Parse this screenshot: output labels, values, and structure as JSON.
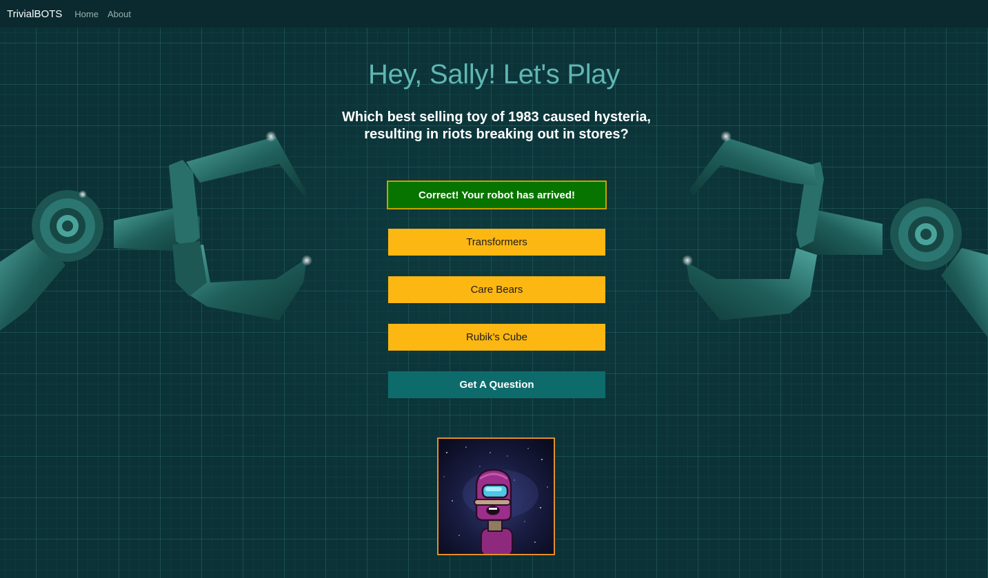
{
  "navbar": {
    "brand": "TrivialBOTS",
    "links": [
      "Home",
      "About"
    ]
  },
  "greeting": "Hey, Sally! Let's Play",
  "question": "Which best selling toy of 1983 caused hysteria, resulting in riots breaking out in stores?",
  "answers": [
    {
      "label": "Correct! Your robot has arrived!",
      "state": "correct"
    },
    {
      "label": "Transformers",
      "state": "default"
    },
    {
      "label": "Care Bears",
      "state": "default"
    },
    {
      "label": "Rubik’s Cube",
      "state": "default"
    }
  ],
  "get_question_label": "Get A Question",
  "robot_image": {
    "icon": "robot-avatar-icon"
  },
  "colors": {
    "background": "#0b3236",
    "navbar": "#0a2a2f",
    "greeting": "#5fb7b4",
    "answer_default": "#fcb712",
    "answer_correct": "#087400",
    "get_question": "#0e6b6b",
    "robot_frame": "#e58f28"
  }
}
